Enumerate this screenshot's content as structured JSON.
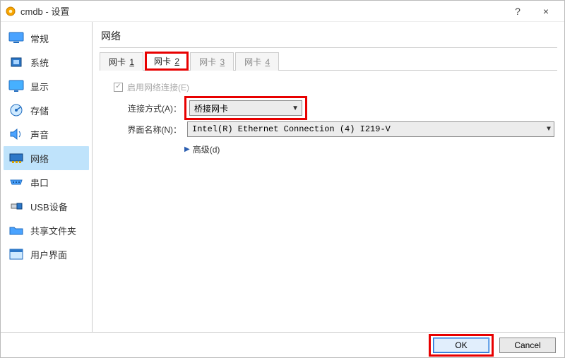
{
  "window": {
    "title": "cmdb - 设置",
    "help": "?",
    "close": "×"
  },
  "sidebar": {
    "items": [
      {
        "label": "常规",
        "icon": "monitor"
      },
      {
        "label": "系统",
        "icon": "chip"
      },
      {
        "label": "显示",
        "icon": "display"
      },
      {
        "label": "存储",
        "icon": "disk"
      },
      {
        "label": "声音",
        "icon": "speaker"
      },
      {
        "label": "网络",
        "icon": "nic",
        "selected": true
      },
      {
        "label": "串口",
        "icon": "serial"
      },
      {
        "label": "USB设备",
        "icon": "usb"
      },
      {
        "label": "共享文件夹",
        "icon": "folder"
      },
      {
        "label": "用户界面",
        "icon": "ui"
      }
    ]
  },
  "section": {
    "title": "网络"
  },
  "tabs": [
    {
      "label": "网卡",
      "num": "1",
      "enabled": true,
      "active": false
    },
    {
      "label": "网卡",
      "num": "2",
      "enabled": true,
      "active": true,
      "highlight": true
    },
    {
      "label": "网卡",
      "num": "3",
      "enabled": false,
      "active": false
    },
    {
      "label": "网卡",
      "num": "4",
      "enabled": false,
      "active": false
    }
  ],
  "form": {
    "enable_label": "启用网络连接(E)",
    "enable_checked": true,
    "attach_label": "连接方式(A)：",
    "attach_value": "桥接网卡",
    "ifname_label": "界面名称(N)：",
    "ifname_value": "Intel(R) Ethernet Connection (4) I219-V",
    "advanced_label": "高级(d)"
  },
  "footer": {
    "ok": "OK",
    "cancel": "Cancel"
  }
}
